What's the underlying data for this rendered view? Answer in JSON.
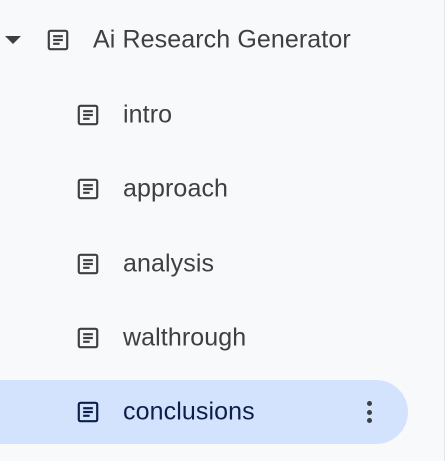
{
  "outline": {
    "root": {
      "label": "Ai Research Generator",
      "expanded": true,
      "icon": "document-icon"
    },
    "children": [
      {
        "label": "intro",
        "icon": "document-icon",
        "selected": false
      },
      {
        "label": "approach",
        "icon": "document-icon",
        "selected": false
      },
      {
        "label": "analysis",
        "icon": "document-icon",
        "selected": false
      },
      {
        "label": "walthrough",
        "icon": "document-icon",
        "selected": false
      },
      {
        "label": "conclusions",
        "icon": "document-icon",
        "selected": true
      }
    ]
  },
  "colors": {
    "background": "#f8f9fa",
    "selected_background": "#d3e3fd",
    "text": "#3c4043",
    "selected_text": "#0b1f4a"
  }
}
